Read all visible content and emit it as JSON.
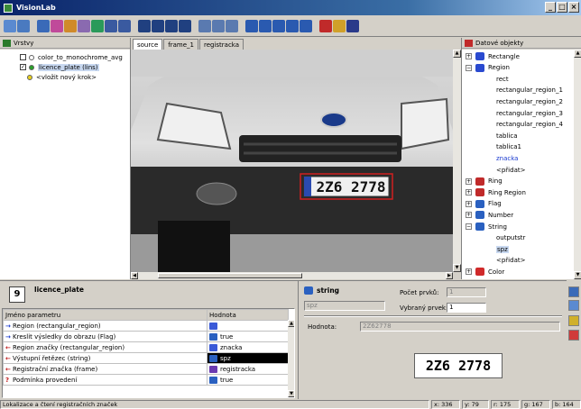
{
  "app": {
    "title": "VisionLab"
  },
  "window_buttons": [
    "_",
    "□",
    "×"
  ],
  "layers_pane": {
    "title": "Vrstvy",
    "items": [
      {
        "label": "color_to_monochrome_avg",
        "checked": false,
        "dot": "#ffffff"
      },
      {
        "label": "licence_plate (lins)",
        "checked": true,
        "dot": "#2aa02a",
        "selected": true
      },
      {
        "label": "<vložit nový krok>",
        "dot": "#e8d020"
      }
    ]
  },
  "tabs": [
    "source",
    "frame_1",
    "registracka"
  ],
  "plate": {
    "text": "2Z6 2778"
  },
  "objects_pane": {
    "title": "Datové objekty",
    "items": [
      {
        "label": "Rectangle",
        "level": 0,
        "expander": "+",
        "icon": "rect-icon",
        "color": "#2a4ad0"
      },
      {
        "label": "Region",
        "level": 0,
        "expander": "−",
        "icon": "region-icon",
        "color": "#2a4ad0"
      },
      {
        "label": "rect",
        "level": 1
      },
      {
        "label": "rectangular_region_1",
        "level": 1
      },
      {
        "label": "rectangular_region_2",
        "level": 1
      },
      {
        "label": "rectangular_region_3",
        "level": 1
      },
      {
        "label": "rectangular_region_4",
        "level": 1
      },
      {
        "label": "tablica",
        "level": 1
      },
      {
        "label": "tablica1",
        "level": 1
      },
      {
        "label": "znacka",
        "level": 1,
        "highlight": true
      },
      {
        "label": "<přidat>",
        "level": 1,
        "add": true
      },
      {
        "label": "Ring",
        "level": 0,
        "expander": "+",
        "icon": "ring-icon",
        "color": "#c02a2a"
      },
      {
        "label": "Ring Region",
        "level": 0,
        "expander": "+",
        "icon": "ring-region-icon",
        "color": "#c02a2a"
      },
      {
        "label": "Flag",
        "level": 0,
        "expander": "+",
        "icon": "flag-icon",
        "color": "#2a60c0"
      },
      {
        "label": "Number",
        "level": 0,
        "expander": "+",
        "icon": "number-icon",
        "color": "#2a60c0"
      },
      {
        "label": "String",
        "level": 0,
        "expander": "−",
        "icon": "string-icon",
        "color": "#2a60c0"
      },
      {
        "label": "outputstr",
        "level": 1
      },
      {
        "label": "spz",
        "level": 1,
        "selected": true
      },
      {
        "label": "<přidat>",
        "level": 1,
        "add": true
      },
      {
        "label": "Color",
        "level": 0,
        "expander": "+",
        "icon": "color-icon",
        "color": "#d02a2a"
      }
    ]
  },
  "step": {
    "title": "licence_plate",
    "icon_label": "9"
  },
  "params_table": {
    "headers": [
      "Jméno parametru",
      "Hodnota"
    ],
    "rows": [
      {
        "dir": "→",
        "dir_color": "#1a3ad0",
        "name": "Region (rectangular_region)",
        "value": "",
        "icon_color": "#3a5ad8"
      },
      {
        "dir": "→",
        "dir_color": "#1a3ad0",
        "name": "Kreslit výsledky do obrazu (Flag)",
        "value": "true",
        "icon_color": "#2a60c0"
      },
      {
        "dir": "←",
        "dir_color": "#c01a1a",
        "name": "Region značky (rectangular_region)",
        "value": "znacka",
        "icon_color": "#3a5ad8"
      },
      {
        "dir": "←",
        "dir_color": "#c01a1a",
        "name": "Výstupní řetězec (string)",
        "value": "spz",
        "icon_color": "#2a60c0",
        "selected": true
      },
      {
        "dir": "←",
        "dir_color": "#c01a1a",
        "name": "Registrační značka (frame)",
        "value": "registracka",
        "icon_color": "#6a3ab0"
      },
      {
        "dir": "?",
        "dir_color": "#c01a1a",
        "name": "Podmínka provedení",
        "value": "true",
        "icon_color": "#2a60c0"
      }
    ]
  },
  "object_detail": {
    "type": "string",
    "name_value": "spz",
    "count_label": "Počet prvků:",
    "count_value": "1",
    "selected_label": "Vybraný prvek:",
    "selected_value": "1",
    "value_label": "Hodnota:",
    "value_text": "2Z62778",
    "preview_text": "2Z6 2778"
  },
  "status": {
    "message": "Lokalizace a čtení registračních značek",
    "x": "x: 336",
    "y": "y: 79",
    "r": "r: 175",
    "g": "g: 167",
    "b": "b: 164"
  }
}
